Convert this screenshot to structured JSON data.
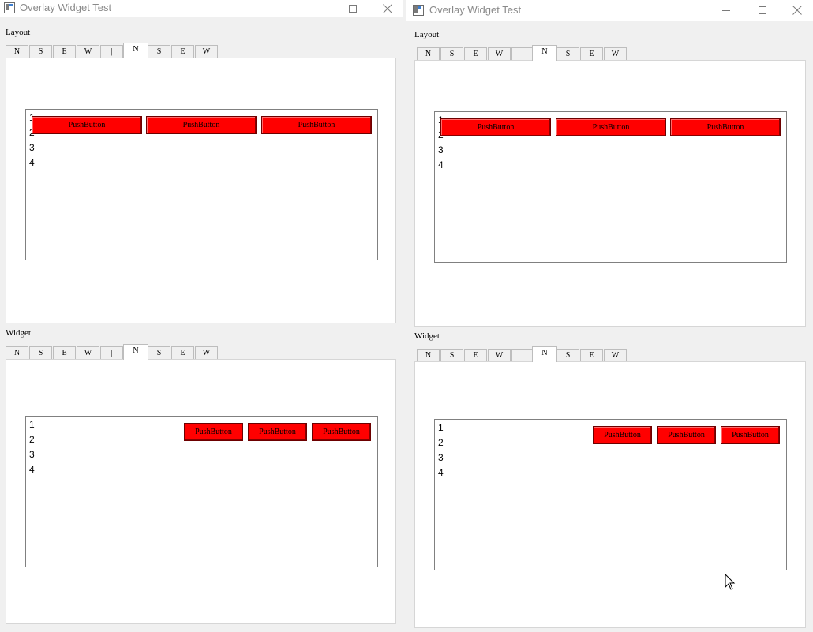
{
  "windows": [
    {
      "title": "Overlay Widget Test",
      "controls": {
        "minimize": "minimize-icon",
        "maximize": "maximize-icon",
        "close": "close-icon"
      },
      "groups": [
        {
          "label": "Layout",
          "tabs": [
            "N",
            "S",
            "E",
            "W",
            "|",
            "N",
            "S",
            "E",
            "W"
          ],
          "selected_tab": 5,
          "list_items": [
            "1",
            "2",
            "3",
            "4"
          ],
          "buttons": [
            "PushButton",
            "PushButton",
            "PushButton"
          ]
        },
        {
          "label": "Widget",
          "tabs": [
            "N",
            "S",
            "E",
            "W",
            "|",
            "N",
            "S",
            "E",
            "W"
          ],
          "selected_tab": 5,
          "list_items": [
            "1",
            "2",
            "3",
            "4"
          ],
          "buttons": [
            "PushButton",
            "PushButton",
            "PushButton"
          ]
        }
      ]
    },
    {
      "title": "Overlay Widget Test",
      "controls": {
        "minimize": "minimize-icon",
        "maximize": "maximize-icon",
        "close": "close-icon"
      },
      "groups": [
        {
          "label": "Layout",
          "tabs": [
            "N",
            "S",
            "E",
            "W",
            "|",
            "N",
            "S",
            "E",
            "W"
          ],
          "selected_tab": 5,
          "list_items": [
            "1",
            "2",
            "3",
            "4"
          ],
          "buttons": [
            "PushButton",
            "PushButton",
            "PushButton"
          ]
        },
        {
          "label": "Widget",
          "tabs": [
            "N",
            "S",
            "E",
            "W",
            "|",
            "N",
            "S",
            "E",
            "W"
          ],
          "selected_tab": 5,
          "list_items": [
            "1",
            "2",
            "3",
            "4"
          ],
          "buttons": [
            "PushButton",
            "PushButton",
            "PushButton"
          ]
        }
      ]
    }
  ],
  "colors": {
    "button_bg": "#ff0000",
    "page_bg": "#ffffff",
    "window_bg": "#f0f0f0"
  }
}
